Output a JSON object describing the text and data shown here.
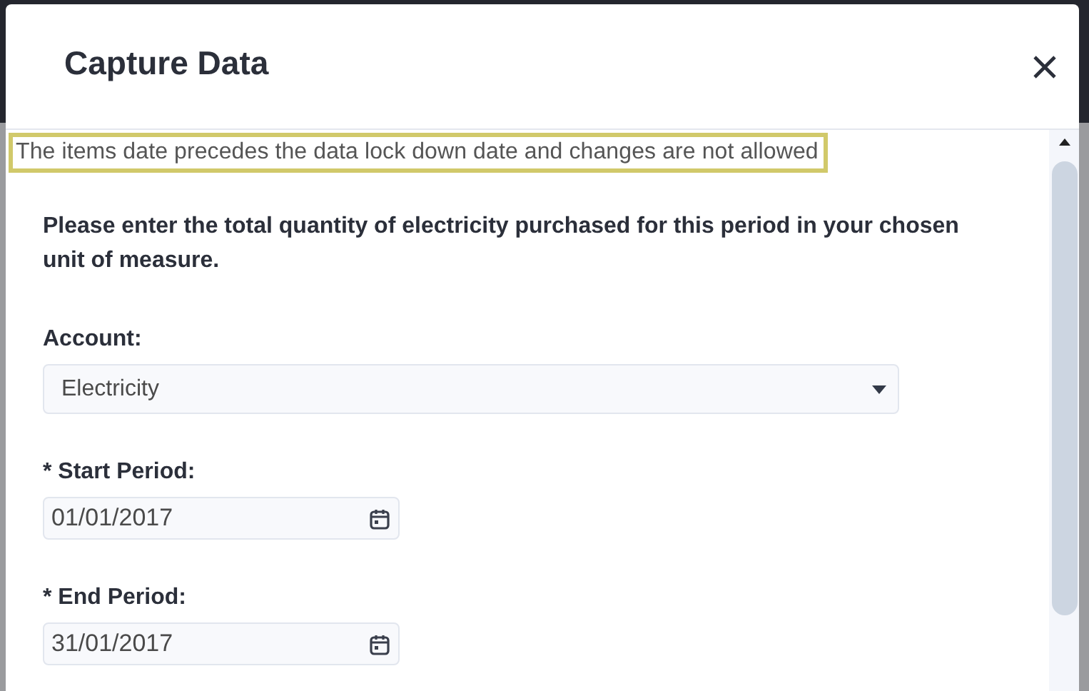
{
  "dialog": {
    "title": "Capture Data"
  },
  "warning": "The items date precedes the data lock down date and changes are not allowed",
  "instruction": "Please enter the total quantity of electricity purchased for this period in your chosen unit of measure.",
  "fields": [
    {
      "kind": "select",
      "label": "Account:",
      "value": "Electricity"
    },
    {
      "kind": "date",
      "label": "* Start Period:",
      "value": "01/01/2017"
    },
    {
      "kind": "date",
      "label": "* End Period:",
      "value": "31/01/2017"
    }
  ]
}
